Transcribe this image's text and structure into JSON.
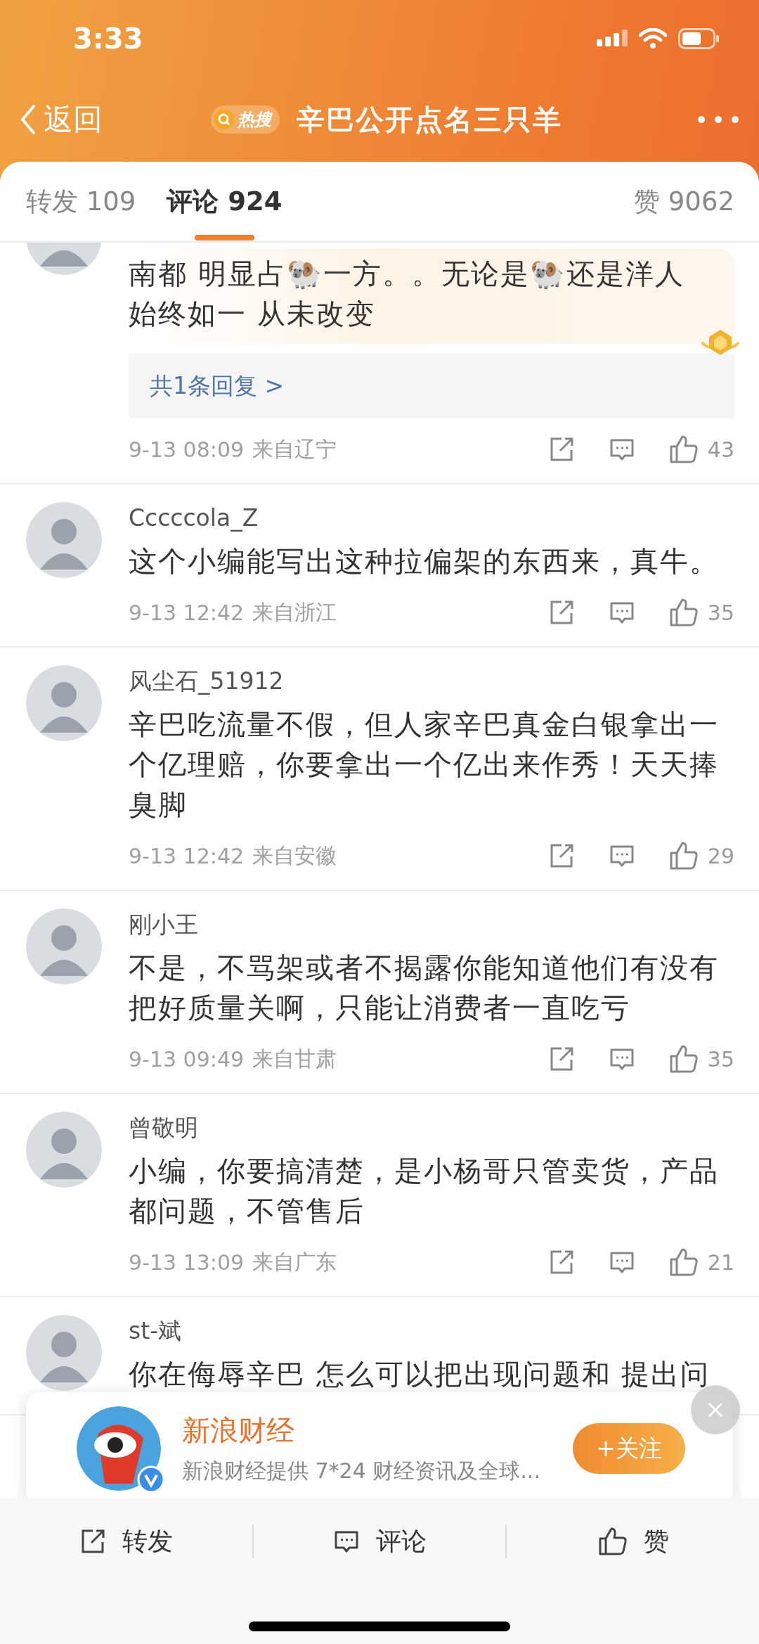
{
  "status_bar": {
    "time": "3:33"
  },
  "nav": {
    "back": "返回",
    "hot_badge": "热搜",
    "title": "辛巴公开点名三只羊"
  },
  "tabs": [
    {
      "label": "转发 109",
      "selected": false
    },
    {
      "label": "评论 924",
      "selected": true
    },
    {
      "label": "赞 9062",
      "selected": false
    }
  ],
  "comments": [
    {
      "highlighted": true,
      "text": "南都 明显占🐏一方。。无论是🐏还是洋人始终如一 从未改变",
      "replies": "共1条回复 >",
      "date": "9-13 08:09",
      "location": "来自辽宁",
      "likes": "43"
    },
    {
      "highlighted": false,
      "username": "Cccccola_Z",
      "text": "这个小编能写出这种拉偏架的东西来，真牛。",
      "date": "9-13 12:42",
      "location": "来自浙江",
      "likes": "35"
    },
    {
      "highlighted": false,
      "username": "风尘石_51912",
      "text": "辛巴吃流量不假，但人家辛巴真金白银拿出一个亿理赔，你要拿出一个亿出来作秀！天天捧臭脚",
      "date": "9-13 12:42",
      "location": "来自安徽",
      "likes": "29"
    },
    {
      "highlighted": false,
      "username": "刚小王",
      "text": "不是，不骂架或者不揭露你能知道他们有没有把好质量关啊，只能让消费者一直吃亏",
      "date": "9-13 09:49",
      "location": "来自甘肃",
      "likes": "35"
    },
    {
      "highlighted": false,
      "username": "曾敬明",
      "text": "小编，你要搞清楚，是小杨哥只管卖货，产品都问题，不管售后",
      "date": "9-13 13:09",
      "location": "来自广东",
      "likes": "21"
    },
    {
      "highlighted": false,
      "username": "st-斌",
      "text": "你在侮辱辛巴 怎么可以把出现问题和 提出问"
    }
  ],
  "popup": {
    "name": "新浪财经",
    "description": "新浪财经提供 7*24 财经资讯及全球...",
    "follow": "+关注"
  },
  "actions": [
    {
      "kind": "repost",
      "label": "转发"
    },
    {
      "kind": "comment",
      "label": "评论"
    },
    {
      "kind": "like",
      "label": "赞"
    }
  ]
}
